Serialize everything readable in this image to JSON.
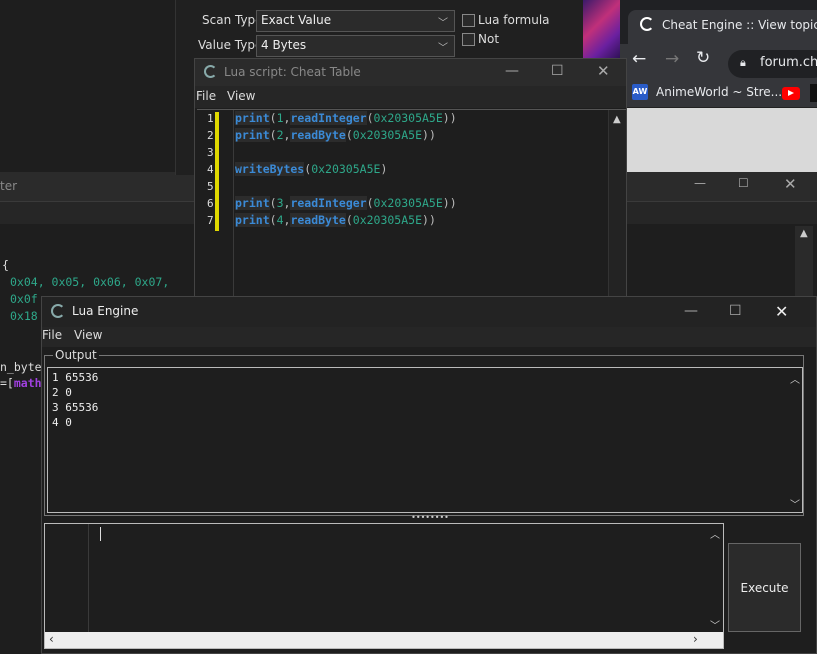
{
  "main_window": {
    "scan_type_label": "Scan Type",
    "scan_type_value": "Exact Value",
    "value_type_label": "Value Type",
    "value_type_value": "4 Bytes",
    "lua_formula_label": "Lua formula",
    "not_label": "Not"
  },
  "chrome": {
    "tab_title": "Cheat Engine :: View topic - S",
    "address": "forum.ch",
    "bookmark_1": "AnimeWorld ~ Stre...",
    "bookmark_1_icon": "AW"
  },
  "bg_editor": {
    "title_fragment": "ter",
    "lines": [
      "{",
      "0x04, 0x05, 0x06, 0x07,",
      "0x0f",
      "0x18",
      "",
      "",
      "n_byte",
      "=["
    ],
    "math_fragment": "math"
  },
  "lua_script": {
    "title": "Lua script: Cheat Table",
    "menu": [
      "File",
      "View"
    ],
    "line_numbers": [
      "1",
      "2",
      "3",
      "4",
      "5",
      "6",
      "7"
    ]
  },
  "lua_engine": {
    "title": "Lua Engine",
    "menu": [
      "File",
      "View"
    ],
    "output_label": "Output",
    "output_lines": [
      "1 65536",
      "2 0",
      "3 65536",
      "4 0"
    ],
    "execute_label": "Execute",
    "splitter_glyph": "••••••••"
  },
  "colors": {
    "keyword": "#3b8ad6",
    "number": "#2ea88a",
    "change_marker": "#e0d800"
  }
}
